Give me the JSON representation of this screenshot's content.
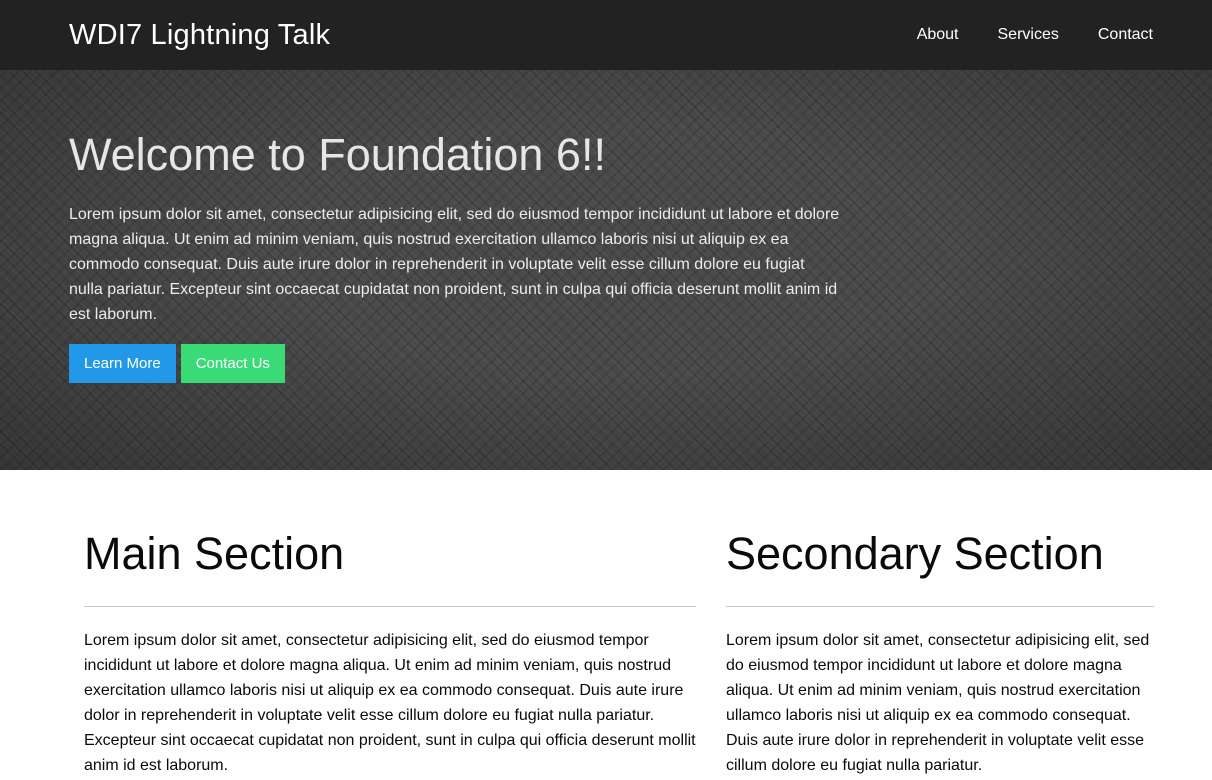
{
  "topbar": {
    "brand": "WDI7 Lightning Talk",
    "menu": [
      "About",
      "Services",
      "Contact"
    ]
  },
  "hero": {
    "title": "Welcome to Foundation 6!!",
    "text": "Lorem ipsum dolor sit amet, consectetur adipisicing elit, sed do eiusmod tempor incididunt ut labore et dolore magna aliqua. Ut enim ad minim veniam, quis nostrud exercitation ullamco laboris nisi ut aliquip ex ea commodo consequat. Duis aute irure dolor in reprehenderit in voluptate velit esse cillum dolore eu fugiat nulla pariatur. Excepteur sint occaecat cupidatat non proident, sunt in culpa qui officia deserunt mollit anim id est laborum.",
    "buttons": {
      "learn_more": "Learn More",
      "contact_us": "Contact Us"
    }
  },
  "main_section": {
    "title": "Main Section",
    "text": "Lorem ipsum dolor sit amet, consectetur adipisicing elit, sed do eiusmod tempor incididunt ut labore et dolore magna aliqua. Ut enim ad minim veniam, quis nostrud exercitation ullamco laboris nisi ut aliquip ex ea commodo consequat. Duis aute irure dolor in reprehenderit in voluptate velit esse cillum dolore eu fugiat nulla pariatur. Excepteur sint occaecat cupidatat non proident, sunt in culpa qui officia deserunt mollit anim id est laborum."
  },
  "secondary_section": {
    "title": "Secondary Section",
    "text": "Lorem ipsum dolor sit amet, consectetur adipisicing elit, sed do eiusmod tempor incididunt ut labore et dolore magna aliqua. Ut enim ad minim veniam, quis nostrud exercitation ullamco laboris nisi ut aliquip ex ea commodo consequat. Duis aute irure dolor in reprehenderit in voluptate velit esse cillum dolore eu fugiat nulla pariatur."
  },
  "colors": {
    "topbar": "#222222",
    "primary": "#2199e8",
    "success": "#3adb76",
    "hero_bg": "#4a4a4a"
  }
}
